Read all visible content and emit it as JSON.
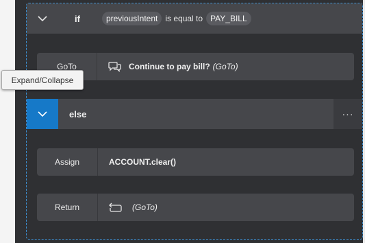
{
  "if_block": {
    "keyword": "if",
    "variable": "previousIntent",
    "operator": "is equal to",
    "value": "PAY_BILL"
  },
  "goto_action": {
    "label": "GoTo",
    "target": "Continue to pay bill?",
    "suffix": "(GoTo)"
  },
  "tooltip": {
    "text": "Expand/Collapse"
  },
  "else_block": {
    "keyword": "else",
    "more": "···"
  },
  "assign_action": {
    "label": "Assign",
    "expression": "ACCOUNT.clear()"
  },
  "return_action": {
    "label": "Return",
    "suffix": "(GoTo)"
  },
  "icons": {
    "if_toggle": "chevron-down-icon",
    "else_toggle": "chevron-down-icon",
    "goto": "chat-bubbles-icon",
    "return": "return-loop-icon",
    "more": "ellipsis-icon"
  },
  "colors": {
    "accent": "#1679c8",
    "selection": "#3d8fd1",
    "bar": "#46474b"
  }
}
